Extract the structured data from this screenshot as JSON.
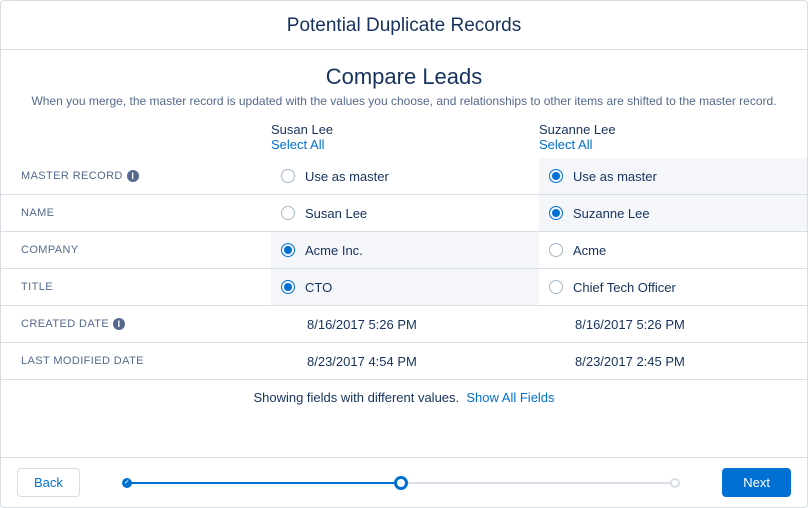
{
  "modal": {
    "title": "Potential Duplicate Records"
  },
  "subheader": {
    "title": "Compare Leads",
    "description": "When you merge, the master record is updated with the values you choose, and relationships to other items are shifted to the master record."
  },
  "records": [
    {
      "name": "Susan Lee",
      "select_all_label": "Select All"
    },
    {
      "name": "Suzanne Lee",
      "select_all_label": "Select All"
    }
  ],
  "rows": {
    "master": {
      "label": "MASTER RECORD",
      "info": true,
      "cells": [
        {
          "value": "Use as master",
          "selected": false
        },
        {
          "value": "Use as master",
          "selected": true
        }
      ]
    },
    "name": {
      "label": "NAME",
      "cells": [
        {
          "value": "Susan Lee",
          "selected": false
        },
        {
          "value": "Suzanne Lee",
          "selected": true
        }
      ]
    },
    "company": {
      "label": "COMPANY",
      "cells": [
        {
          "value": "Acme Inc.",
          "selected": true
        },
        {
          "value": "Acme",
          "selected": false
        }
      ]
    },
    "title": {
      "label": "TITLE",
      "cells": [
        {
          "value": "CTO",
          "selected": true
        },
        {
          "value": "Chief Tech Officer",
          "selected": false
        }
      ]
    },
    "created": {
      "label": "CREATED DATE",
      "info": true,
      "cells": [
        {
          "value": "8/16/2017 5:26 PM"
        },
        {
          "value": "8/16/2017 5:26 PM"
        }
      ]
    },
    "modified": {
      "label": "LAST MODIFIED DATE",
      "cells": [
        {
          "value": "8/23/2017 4:54 PM"
        },
        {
          "value": "8/23/2017 2:45 PM"
        }
      ]
    }
  },
  "footer_note": {
    "text": "Showing fields with different values.",
    "link": "Show All Fields"
  },
  "buttons": {
    "back": "Back",
    "next": "Next"
  }
}
